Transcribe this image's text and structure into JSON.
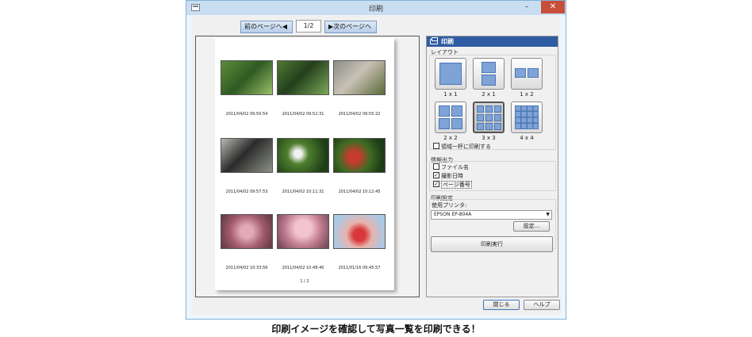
{
  "window": {
    "title": "印刷",
    "minimize_glyph": "–",
    "close_glyph": "✕",
    "icon": "app-window-icon"
  },
  "nav": {
    "prev_label": "前のページへ◀",
    "page_value": "1/2",
    "next_label": "▶次のページへ"
  },
  "preview": {
    "photos": [
      {
        "timestamp": "2011/04/02 09:50:54"
      },
      {
        "timestamp": "2011/04/02 09:52:31"
      },
      {
        "timestamp": "2011/04/02 09:55:22"
      },
      {
        "timestamp": "2011/04/02 09:57:53"
      },
      {
        "timestamp": "2011/04/02 10:11:31"
      },
      {
        "timestamp": "2011/04/02 10:12:45"
      },
      {
        "timestamp": "2011/04/02 10:33:56"
      },
      {
        "timestamp": "2011/04/02 10:48:40"
      },
      {
        "timestamp": "2011/01/16 09:45:57"
      }
    ],
    "page_number": "1 / 2"
  },
  "panel": {
    "header": "印刷",
    "header_icon": "printer-icon",
    "layout_label": "レイアウト",
    "layouts": [
      {
        "label": "1 x 1",
        "selected": false
      },
      {
        "label": "2 x 1",
        "selected": false
      },
      {
        "label": "1 x 2",
        "selected": false
      },
      {
        "label": "2 x 2",
        "selected": false
      },
      {
        "label": "3 x 3",
        "selected": true
      },
      {
        "label": "4 x 4",
        "selected": false
      }
    ],
    "fill_area_label": "領域一杯に印刷する",
    "fill_area_checked": false,
    "info_label": "情報出力",
    "info_options": [
      {
        "label": "ファイル名",
        "checked": false
      },
      {
        "label": "撮影日時",
        "checked": true
      },
      {
        "label": "ページ番号",
        "checked": true
      }
    ],
    "print_settings_label": "印刷設定",
    "printer_label": "使用プリンタ:",
    "printer_value": "EPSON EP-804A",
    "settings_button": "設定...",
    "print_button": "印刷実行"
  },
  "footer": {
    "close_button": "閉じる",
    "help_button": "ヘルプ"
  },
  "caption": "印刷イメージを確認して写真一覧を印刷できる！",
  "colors": {
    "title_bar": "#c9def0",
    "panel_header": "#2f5ba3",
    "close_accent": "#c74f3a"
  }
}
